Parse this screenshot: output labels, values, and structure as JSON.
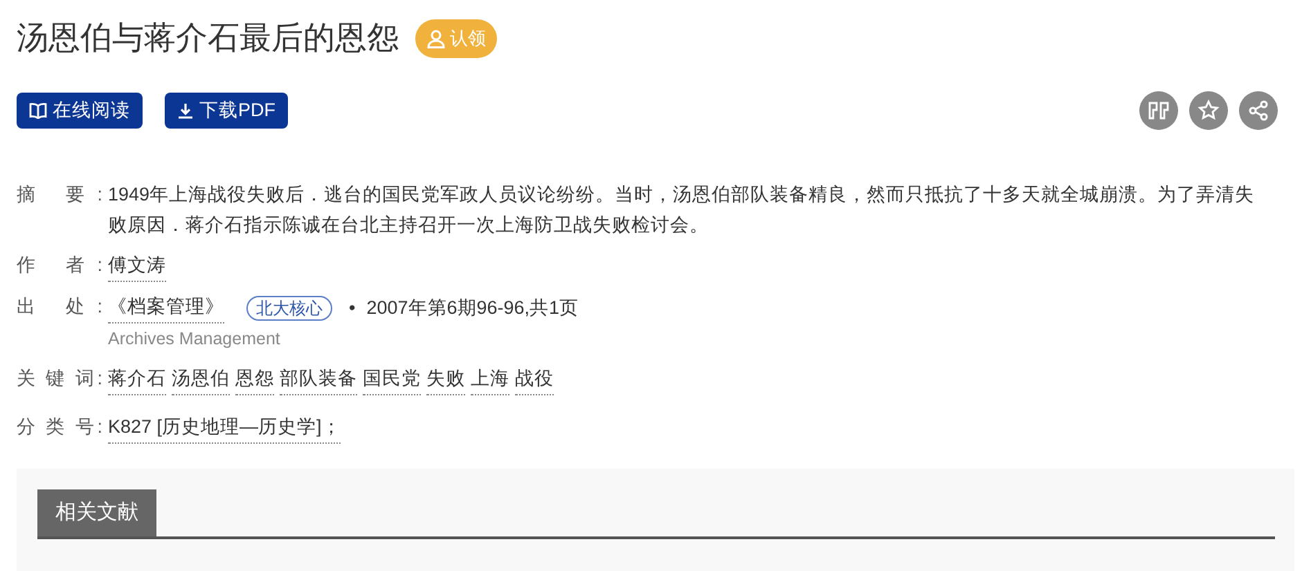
{
  "title": "汤恩伯与蒋介石最后的恩怨",
  "claim_button": "认领",
  "actions": [
    {
      "kind": "read",
      "label": "在线阅读"
    },
    {
      "kind": "download",
      "label": "下载PDF"
    }
  ],
  "tools": [
    {
      "kind": "cite"
    },
    {
      "kind": "favorite"
    },
    {
      "kind": "share"
    }
  ],
  "fields": [
    {
      "kind": "text",
      "label": "摘 要:",
      "text": "1949年上海战役失败后．逃台的国民党军政人员议论纷纷。当时，汤恩伯部队装备精良，然而只抵抗了十多天就全城崩溃。为了弄清失败原因．蒋介石指示陈诚在台北主持召开一次上海防卫战失败检讨会。"
    },
    {
      "kind": "links",
      "label": "作 者:",
      "links": [
        "傅文涛"
      ]
    },
    {
      "kind": "source",
      "label": "出 处:",
      "journal": "《档案管理》",
      "badge": "北大核心",
      "bullet": "•",
      "issue": "2007年第6期96-96,共1页",
      "journal_en": "Archives Management"
    },
    {
      "kind": "links",
      "label": "关 键 词:",
      "links": [
        "蒋介石",
        "汤恩伯",
        "恩怨",
        "部队装备",
        "国民党",
        "失败",
        "上海",
        "战役"
      ]
    },
    {
      "kind": "links",
      "label": "分 类 号:",
      "links": [
        "K827 [历史地理—历史学]；"
      ]
    }
  ],
  "related": {
    "tab": "相关文献"
  }
}
